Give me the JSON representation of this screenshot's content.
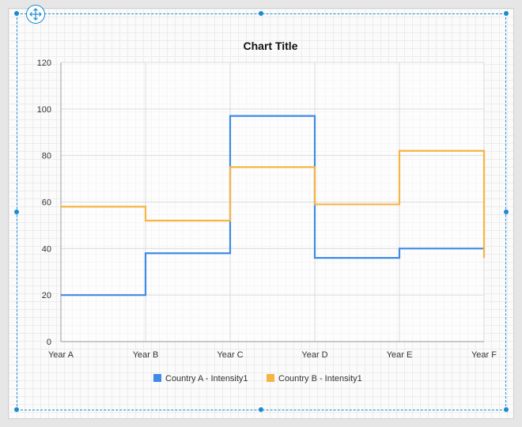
{
  "designer": {
    "move_handle_icon": "move-arrows-icon",
    "selection_color": "#1a8bd1"
  },
  "chart_data": {
    "type": "line",
    "line_style": "step",
    "title": "Chart Title",
    "categories": [
      "Year A",
      "Year B",
      "Year C",
      "Year D",
      "Year E",
      "Year F"
    ],
    "ylim": [
      0,
      120
    ],
    "yticks": [
      0,
      20,
      40,
      60,
      80,
      100,
      120
    ],
    "grid": true,
    "legend_position": "bottom",
    "series": [
      {
        "name": "Country A - Intensity1",
        "color": "#3e8ae6",
        "values": [
          20,
          38,
          97,
          36,
          40,
          40
        ]
      },
      {
        "name": "Country B - Intensity1",
        "color": "#f6b443",
        "values": [
          58,
          52,
          75,
          59,
          82,
          36
        ]
      }
    ]
  }
}
